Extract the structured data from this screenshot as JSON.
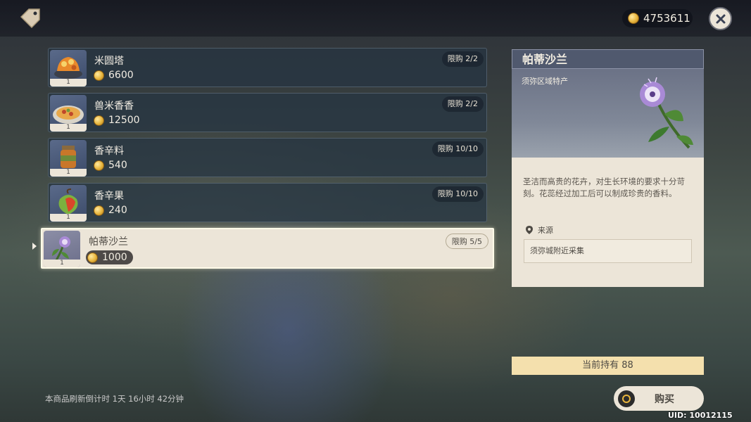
{
  "header": {
    "shop_icon": "price-tag-icon",
    "currency_icon": "mora-coin-icon",
    "currency_amount": "4753611",
    "close_icon": "close-icon"
  },
  "items": [
    {
      "name": "米圆塔",
      "price": "6600",
      "limit": "限购 2/2",
      "qty": "1",
      "icon": "rice-cake-tower-icon"
    },
    {
      "name": "兽米香香",
      "price": "12500",
      "limit": "限购 2/2",
      "qty": "1",
      "icon": "meat-rice-dish-icon"
    },
    {
      "name": "香辛料",
      "price": "540",
      "limit": "限购 10/10",
      "qty": "1",
      "icon": "spice-jar-icon"
    },
    {
      "name": "香辛果",
      "price": "240",
      "limit": "限购 10/10",
      "qty": "1",
      "icon": "spice-fruit-icon"
    },
    {
      "name": "帕蒂沙兰",
      "price": "1000",
      "limit": "限购 5/5",
      "qty": "1",
      "icon": "padisarah-flower-icon",
      "selected": true
    }
  ],
  "detail": {
    "title": "帕蒂沙兰",
    "region": "须弥区域特产",
    "description": "圣洁而高贵的花卉，对生长环境的要求十分苛刻。花蕊经过加工后可以制成珍贵的香料。",
    "source_label": "来源",
    "source_icon": "location-pin-icon",
    "source_value": "须弥城附近采集"
  },
  "owned": "当前持有 88",
  "buy_label": "购买",
  "refresh_text": "本商品刷新倒计时 1天 16小时 42分钟",
  "uid": "UID: 10012115",
  "colors": {
    "accent_cream": "#ece5d8",
    "owned_bar": "#f4e0ad",
    "row_bg": "#263442",
    "detail_header": "#50596e"
  }
}
